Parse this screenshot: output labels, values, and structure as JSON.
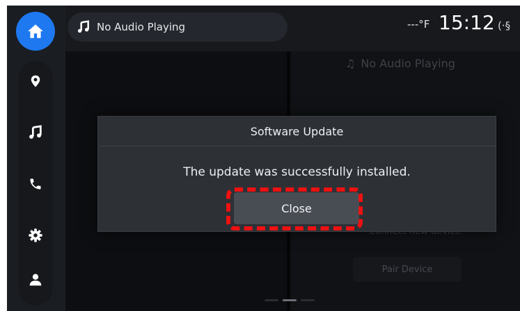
{
  "topbar": {
    "audio_label": "No Audio Playing",
    "temperature": "---°F",
    "time": "15:12",
    "right_icon": "(·§"
  },
  "rail": {
    "items": [
      "home-icon",
      "location-pin-icon",
      "music-note-icon",
      "phone-icon",
      "gear-icon",
      "person-icon"
    ]
  },
  "background": {
    "audio_label": "No Audio Playing",
    "status_text": "Connect new device",
    "pair_button": "Pair Device"
  },
  "dialog": {
    "title": "Software Update",
    "message": "The update was successfully installed.",
    "close_label": "Close"
  },
  "colors": {
    "accent": "#1e78f0",
    "highlight": "#ee1111",
    "dialog_bg": "#2d3035",
    "button_bg": "#484c53"
  }
}
